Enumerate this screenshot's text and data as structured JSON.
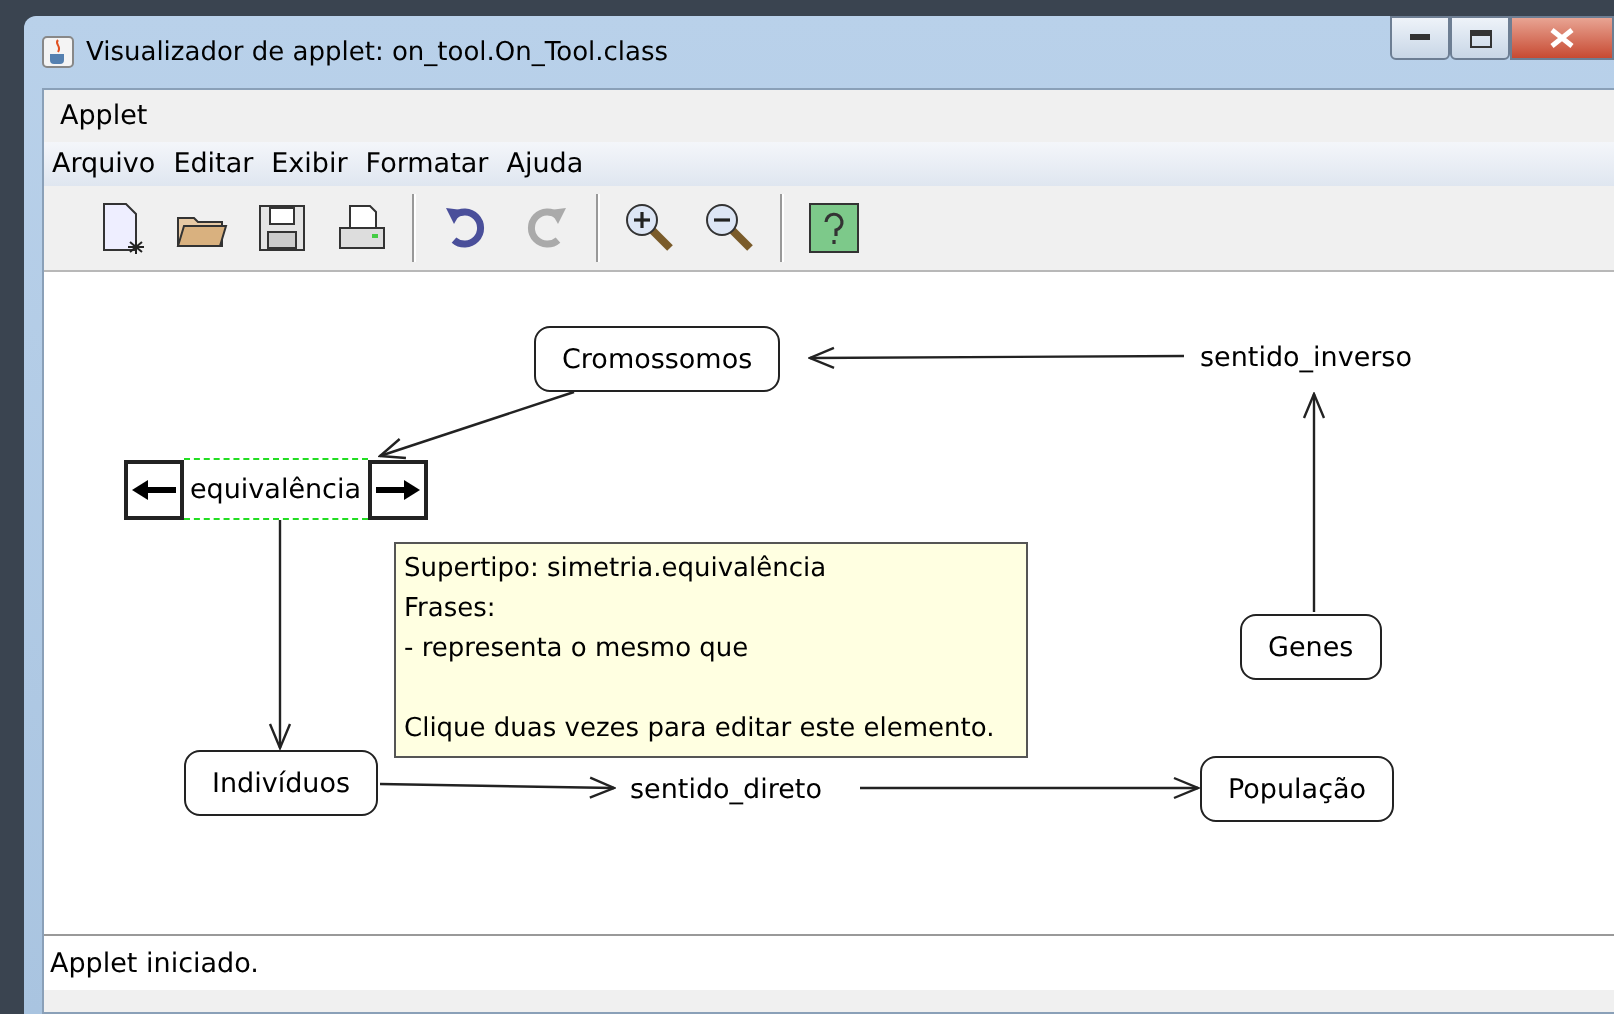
{
  "window": {
    "title": "Visualizador de applet: on_tool.On_Tool.class"
  },
  "applet_menu": {
    "label": "Applet"
  },
  "menu": [
    {
      "label": "Arquivo"
    },
    {
      "label": "Editar"
    },
    {
      "label": "Exibir"
    },
    {
      "label": "Formatar"
    },
    {
      "label": "Ajuda"
    }
  ],
  "toolbar": [
    {
      "kind": "new",
      "disabled": false
    },
    {
      "kind": "open",
      "disabled": false
    },
    {
      "kind": "save",
      "disabled": false
    },
    {
      "kind": "print",
      "disabled": false
    },
    {
      "kind": "sep"
    },
    {
      "kind": "undo",
      "disabled": false
    },
    {
      "kind": "redo",
      "disabled": true
    },
    {
      "kind": "sep"
    },
    {
      "kind": "zoomin",
      "disabled": false
    },
    {
      "kind": "zoomout",
      "disabled": false
    },
    {
      "kind": "sep"
    },
    {
      "kind": "help",
      "disabled": false
    }
  ],
  "nodes": [
    {
      "kind": "box",
      "label": "Cromossomos"
    },
    {
      "kind": "label",
      "label": "sentido_inverso"
    },
    {
      "kind": "box",
      "label": "Genes"
    },
    {
      "kind": "relation",
      "label": "equivalência",
      "selected": true
    },
    {
      "kind": "box",
      "label": "Indivíduos"
    },
    {
      "kind": "label",
      "label": "sentido_direto"
    },
    {
      "kind": "box",
      "label": "População"
    }
  ],
  "tooltip": {
    "lines": [
      "Supertipo: simetria.equivalência",
      "Frases:",
      "- representa o mesmo que"
    ],
    "hint": "Clique duas vezes para editar este elemento."
  },
  "status_bar": "Applet iniciado."
}
